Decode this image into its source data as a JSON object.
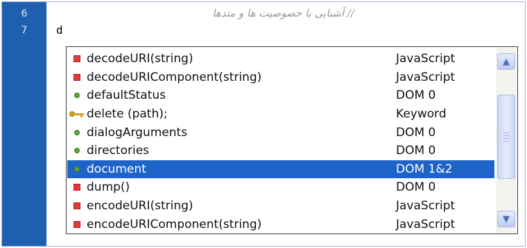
{
  "gutter": {
    "line_numbers": [
      "6",
      "7"
    ]
  },
  "editor": {
    "lines": [
      {
        "number": "6",
        "text": "// آشنایی با خصوصیت ها و متدها"
      },
      {
        "number": "7",
        "text": "d"
      }
    ]
  },
  "autocomplete": {
    "items": [
      {
        "name": "decodeURI(string)",
        "type": "JavaScript",
        "icon": "method-icon",
        "selected": false
      },
      {
        "name": "decodeURIComponent(string)",
        "type": "JavaScript",
        "icon": "method-icon",
        "selected": false
      },
      {
        "name": "defaultStatus",
        "type": "DOM 0",
        "icon": "property-icon",
        "selected": false
      },
      {
        "name": "delete (path);",
        "type": "Keyword",
        "icon": "keyword-icon",
        "selected": false
      },
      {
        "name": "dialogArguments",
        "type": "DOM 0",
        "icon": "property-icon",
        "selected": false
      },
      {
        "name": "directories",
        "type": "DOM 0",
        "icon": "property-icon",
        "selected": false
      },
      {
        "name": "document",
        "type": "DOM 1&2",
        "icon": "property-icon",
        "selected": true
      },
      {
        "name": "dump()",
        "type": "DOM 0",
        "icon": "method-icon",
        "selected": false
      },
      {
        "name": "encodeURI(string)",
        "type": "JavaScript",
        "icon": "method-icon",
        "selected": false
      },
      {
        "name": "encodeURIComponent(string)",
        "type": "JavaScript",
        "icon": "method-icon",
        "selected": false
      }
    ]
  },
  "colors": {
    "gutter": "#1f5fb0",
    "selection": "#1e64c8",
    "method_icon": "#e03a3a",
    "property_icon": "#5aa832",
    "keyword_icon": "#d6a21c"
  }
}
